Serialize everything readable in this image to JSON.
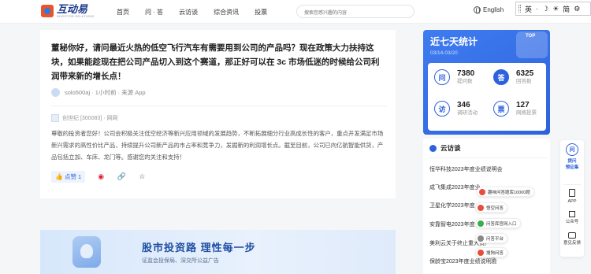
{
  "header": {
    "logo_title": "互动易",
    "logo_sub": "INVESTOR RELATIONS",
    "nav": [
      "首页",
      "问 · 答",
      "云访谈",
      "综合资讯",
      "投票"
    ],
    "search_placeholder": "搜索您感兴趣的内容",
    "language": "English",
    "ime": [
      "英",
      "简"
    ]
  },
  "question": {
    "title": "董秘你好，请问最近火热的低空飞行汽车有需要用到公司的产品吗？现在政策大力扶持这块，如果能趁现在把公司产品切入到这个赛道，那正好可以在 3c 市场低迷的时候给公司利润带来新的增长点！",
    "author": "solo500aj · 1小时前 · 来源 App",
    "company": "创世纪 [300083] · 网网",
    "answer": "尊敬的投资者您好！公司会积极关注低空经济等新兴应用领域的发展趋势，不断拓展细分行业高成长性的客户，重点开发满足市场新兴需求的高性价比产品，持续提升公司新产品的市占率和竞争力，发掘新的利润增长点。截至目前，公司已向亿航智能供货，产品包括立加、车床、龙门等。感谢您的关注和支持！",
    "like_label": "点赞 1"
  },
  "banner": {
    "title": "股市投资路 理性每一步",
    "subtitle": "证监会投保局、深交所公益广告"
  },
  "stats": {
    "title": "近七天统计",
    "date_range": "03/14-03/20",
    "badge": "TOP",
    "items": [
      {
        "icon": "问",
        "value": "7380",
        "label": "提问数"
      },
      {
        "icon": "答",
        "value": "6325",
        "label": "回答数"
      },
      {
        "icon": "访",
        "value": "346",
        "label": "调研活动"
      },
      {
        "icon": "票",
        "value": "127",
        "label": "网络投票"
      }
    ]
  },
  "visits": {
    "title": "云访谈",
    "items": [
      "恒华科技2023年度业绩说明会",
      "成飞集成2023年度业",
      "卫星化学2023年度",
      "安靠智电2023年度",
      "美利云关于终止重大资产",
      "保龄宝2023年度业绩说明会"
    ]
  },
  "popup": [
    {
      "label": "趣味问答题库10000题",
      "color": "#e84c3d"
    },
    {
      "label": "悟空问答",
      "color": "#e84c3d"
    },
    {
      "label": "问答库官网入口",
      "color": "#37b04a"
    },
    {
      "label": "问答平台",
      "color": "#888888"
    },
    {
      "label": "搜狗问答",
      "color": "#e84c3d"
    }
  ],
  "toolbar": {
    "ask_icon": "问",
    "ask_label": "提问",
    "ask_sub": "预征集",
    "app_label": "APP",
    "wechat_label": "公众号",
    "feedback_label": "意见反馈"
  },
  "colors": {
    "brand_blue": "#2e62dc",
    "like_blue": "#2c63d8",
    "weibo_red": "#e6162d"
  }
}
